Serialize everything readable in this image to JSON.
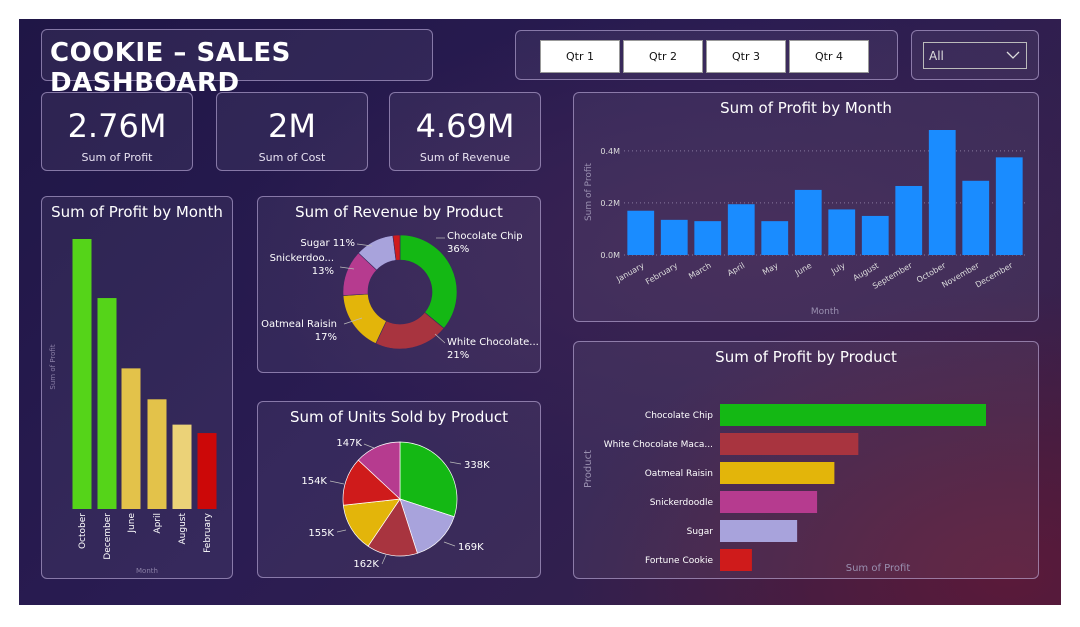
{
  "header": {
    "title": "COOKIE – SALES DASHBOARD"
  },
  "quarters": [
    "Qtr 1",
    "Qtr 2",
    "Qtr 3",
    "Qtr 4"
  ],
  "filter": {
    "value": "All"
  },
  "kpis": [
    {
      "value": "2.76M",
      "label": "Sum of Profit"
    },
    {
      "value": "2M",
      "label": "Sum of Cost"
    },
    {
      "value": "4.69M",
      "label": "Sum of Revenue"
    }
  ],
  "chart_data": [
    {
      "id": "profit_month_top",
      "type": "bar",
      "title": "Sum of Profit by Month",
      "xlabel": "Month",
      "ylabel": "Sum of Profit",
      "categories": [
        "January",
        "February",
        "March",
        "April",
        "May",
        "June",
        "July",
        "August",
        "September",
        "October",
        "November",
        "December"
      ],
      "values": [
        0.17,
        0.135,
        0.13,
        0.195,
        0.13,
        0.25,
        0.175,
        0.15,
        0.265,
        0.48,
        0.285,
        0.375
      ],
      "ylim": [
        0,
        0.48
      ],
      "yticks": [
        "0.0M",
        "0.2M",
        "0.4M"
      ],
      "grid": true,
      "color": "#1a8cff"
    },
    {
      "id": "profit_month_left",
      "type": "bar",
      "title": "Sum of Profit by Month",
      "xlabel": "Month",
      "ylabel": "Sum of Profit",
      "categories": [
        "October",
        "December",
        "June",
        "April",
        "August",
        "February"
      ],
      "values": [
        0.48,
        0.375,
        0.25,
        0.195,
        0.15,
        0.135
      ],
      "colors": [
        "#55d419",
        "#55d419",
        "#e3c24a",
        "#e3c24a",
        "#ebd278",
        "#cc0808"
      ]
    },
    {
      "id": "revenue_product",
      "type": "pie",
      "title": "Sum of Revenue by Product",
      "categories": [
        "Chocolate Chip",
        "White Chocolate...",
        "Oatmeal Raisin",
        "Snickerdoo...",
        "Sugar",
        "Fortune Cookie"
      ],
      "values": [
        36,
        21,
        17,
        13,
        11,
        2
      ],
      "labels": [
        "Chocolate Chip\n36%",
        "White Chocolate...\n21%",
        "Oatmeal Raisin\n17%",
        "Snickerdoo...\n13%",
        "Sugar 11%",
        ""
      ],
      "colors": [
        "#14b814",
        "#a8343f",
        "#e3b50a",
        "#b63b8f",
        "#a8a3dc",
        "#cf1b1b"
      ]
    },
    {
      "id": "units_product",
      "type": "pie",
      "title": "Sum of Units Sold by Product",
      "values": [
        338,
        169,
        162,
        155,
        154,
        147
      ],
      "labels": [
        "338K",
        "169K",
        "162K",
        "155K",
        "154K",
        "147K"
      ],
      "colors": [
        "#14b814",
        "#a8a3dc",
        "#a8343f",
        "#e3b50a",
        "#cf1b1b",
        "#b63b8f"
      ]
    },
    {
      "id": "profit_product",
      "type": "bar",
      "title": "Sum of Profit by Product",
      "xlabel": "Sum of Profit",
      "ylabel": "Product",
      "categories": [
        "Chocolate Chip",
        "White Chocolate Maca...",
        "Oatmeal Raisin",
        "Snickerdoodle",
        "Sugar",
        "Fortune Cookie"
      ],
      "values": [
        1.0,
        0.52,
        0.43,
        0.365,
        0.29,
        0.12
      ],
      "colors": [
        "#14b814",
        "#a8343f",
        "#e3b50a",
        "#b63b8f",
        "#a8a3dc",
        "#cf1b1b"
      ]
    }
  ]
}
